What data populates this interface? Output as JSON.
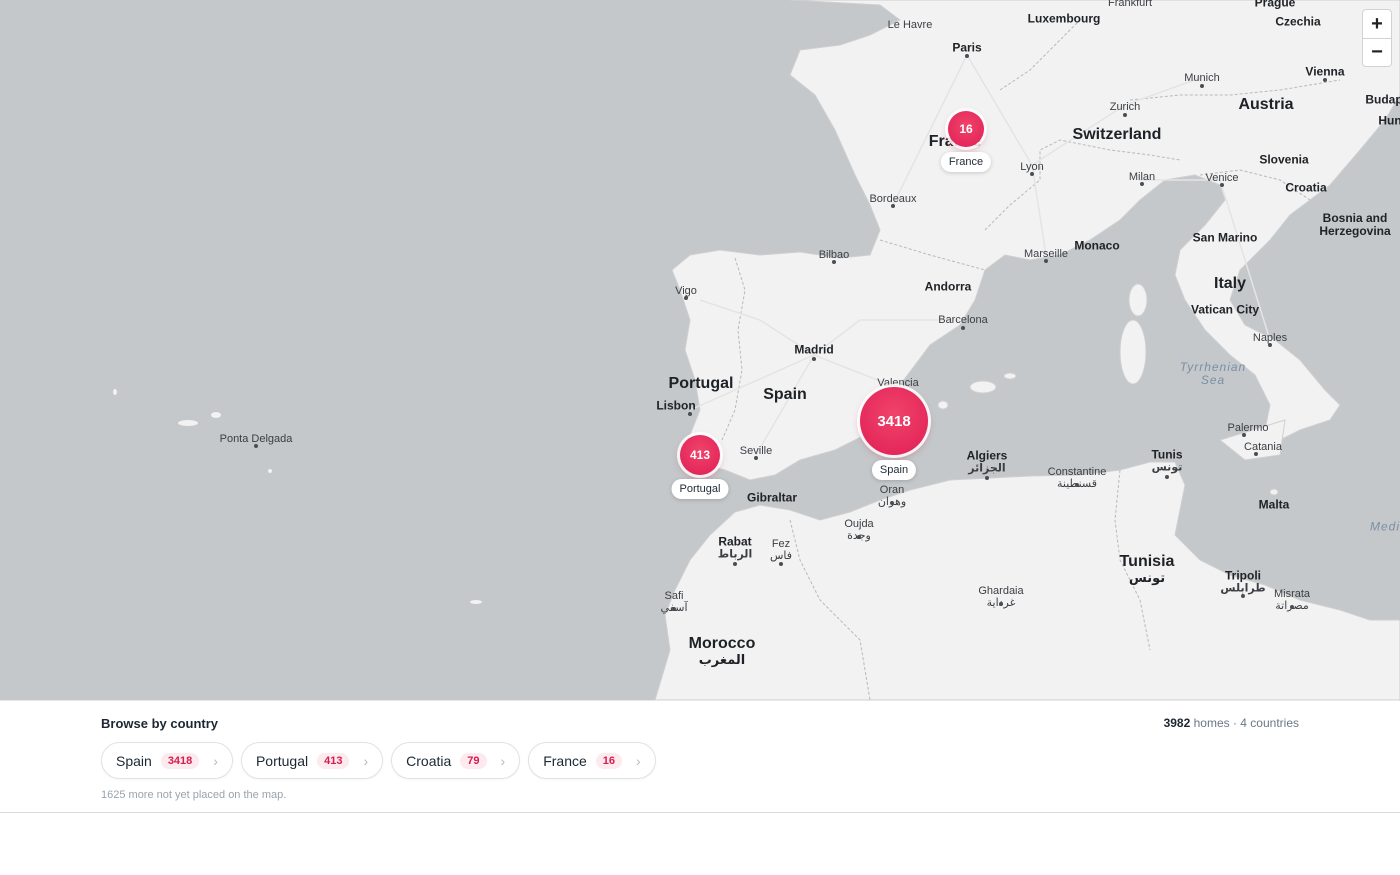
{
  "map": {
    "places": [
      {
        "name": "Le Havre",
        "type": "city",
        "dot": false
      },
      {
        "name": "Paris",
        "type": "bold",
        "dot": true
      },
      {
        "name": "Luxembourg",
        "type": "bold",
        "dot": false
      },
      {
        "name": "Frankfurt",
        "type": "city",
        "dot": false
      },
      {
        "name": "Prague",
        "type": "bold",
        "dot": false
      },
      {
        "name": "Czechia",
        "type": "bold",
        "dot": false
      },
      {
        "name": "Munich",
        "type": "city",
        "dot": true
      },
      {
        "name": "Vienna",
        "type": "bold",
        "dot": true
      },
      {
        "name": "Budap",
        "type": "bold",
        "dot": false
      },
      {
        "name": "Hun",
        "type": "bold",
        "dot": false
      },
      {
        "name": "Zurich",
        "type": "city",
        "dot": true
      },
      {
        "name": "Austria",
        "type": "country",
        "dot": false
      },
      {
        "name": "Switzerland",
        "type": "country",
        "dot": false
      },
      {
        "name": "France",
        "type": "country",
        "dot": false
      },
      {
        "name": "Lyon",
        "type": "city",
        "dot": true
      },
      {
        "name": "Milan",
        "type": "city",
        "dot": true
      },
      {
        "name": "Venice",
        "type": "city",
        "dot": true
      },
      {
        "name": "Slovenia",
        "type": "bold",
        "dot": false
      },
      {
        "name": "Croatia",
        "type": "bold",
        "dot": false
      },
      {
        "name": "Bosnia and\nHerzegovina",
        "type": "bold",
        "dot": false
      },
      {
        "name": "Bordeaux",
        "type": "city",
        "dot": true
      },
      {
        "name": "Bilbao",
        "type": "city",
        "dot": true
      },
      {
        "name": "Marseille",
        "type": "city",
        "dot": true
      },
      {
        "name": "Monaco",
        "type": "bold",
        "dot": false
      },
      {
        "name": "San Marino",
        "type": "bold",
        "dot": false
      },
      {
        "name": "Vigo",
        "type": "city",
        "dot": true
      },
      {
        "name": "Andorra",
        "type": "bold",
        "dot": false
      },
      {
        "name": "Italy",
        "type": "country",
        "dot": false
      },
      {
        "name": "Barcelona",
        "type": "city",
        "dot": true
      },
      {
        "name": "Vatican City",
        "type": "bold",
        "dot": false
      },
      {
        "name": "Naples",
        "type": "city",
        "dot": true
      },
      {
        "name": "Madrid",
        "type": "bold",
        "dot": true
      },
      {
        "name": "Portugal",
        "type": "country",
        "dot": false
      },
      {
        "name": "Spain",
        "type": "country",
        "dot": false
      },
      {
        "name": "Valencia",
        "type": "city",
        "dot": false
      },
      {
        "name": "Tyrrhenian\nSea",
        "type": "sea",
        "dot": false
      },
      {
        "name": "Lisbon",
        "type": "bold",
        "dot": true
      },
      {
        "name": "Palermo",
        "type": "city",
        "dot": true
      },
      {
        "name": "Ponta Delgada",
        "type": "city",
        "dot": true
      },
      {
        "name": "Catania",
        "type": "city",
        "dot": true
      },
      {
        "name": "Seville",
        "type": "city",
        "dot": true
      },
      {
        "name": "Algiers",
        "type": "bold",
        "dot": true,
        "ar": "الجزائر"
      },
      {
        "name": "Tunis",
        "type": "bold",
        "dot": true,
        "ar": "تونس"
      },
      {
        "name": "Constantine",
        "type": "city",
        "dot": true,
        "ar": "قسنطينة"
      },
      {
        "name": "Gibraltar",
        "type": "bold",
        "dot": false
      },
      {
        "name": "Oran",
        "type": "city",
        "dot": true,
        "ar": "وهران"
      },
      {
        "name": "Malta",
        "type": "bold",
        "dot": false
      },
      {
        "name": "Medi",
        "type": "sea",
        "dot": false
      },
      {
        "name": "Oujda",
        "type": "city",
        "dot": true,
        "ar": "وجدة"
      },
      {
        "name": "Rabat",
        "type": "bold",
        "dot": true,
        "ar": "الرباط"
      },
      {
        "name": "Fez",
        "type": "city",
        "dot": true,
        "ar": "فاس"
      },
      {
        "name": "Tunisia",
        "type": "country",
        "dot": false,
        "ar": "تونس"
      },
      {
        "name": "Ghardaia",
        "type": "city",
        "dot": true,
        "ar": "غرداية"
      },
      {
        "name": "Tripoli",
        "type": "bold",
        "dot": true,
        "ar": "طرابلس"
      },
      {
        "name": "Misrata",
        "type": "city",
        "dot": true,
        "ar": "مصراتة"
      },
      {
        "name": "Safi",
        "type": "city",
        "dot": true,
        "ar": "آسفي"
      },
      {
        "name": "Morocco",
        "type": "country",
        "dot": false,
        "ar": "المغرب"
      }
    ],
    "clusters": [
      {
        "country": "France",
        "count": "16",
        "label": "France"
      },
      {
        "country": "Portugal",
        "count": "413",
        "label": "Portugal"
      },
      {
        "country": "Spain",
        "count": "3418",
        "label": "Spain"
      }
    ],
    "zoom_in_label": "+",
    "zoom_out_label": "−"
  },
  "panel": {
    "title": "Browse by country",
    "total_homes": "3982",
    "summary_suffix": "homes · 4 countries",
    "countries": [
      {
        "name": "Spain",
        "count": "3418"
      },
      {
        "name": "Portugal",
        "count": "413"
      },
      {
        "name": "Croatia",
        "count": "79"
      },
      {
        "name": "France",
        "count": "16"
      }
    ],
    "chevron": "›",
    "note": "1625 more not yet placed on the map."
  }
}
